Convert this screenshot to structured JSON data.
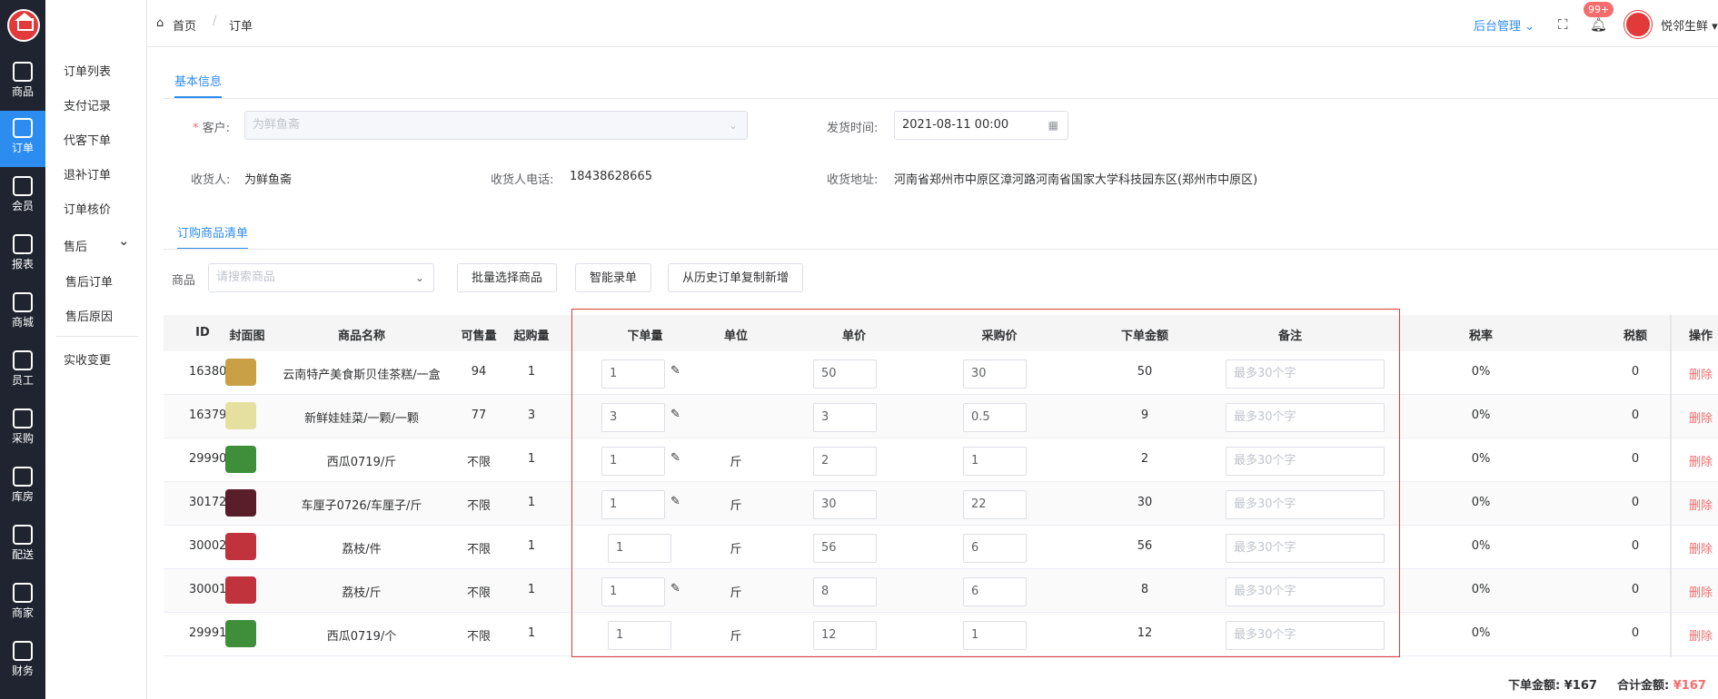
{
  "rail": [
    {
      "label": "商品",
      "icon": "bag-icon"
    },
    {
      "label": "订单",
      "icon": "order-icon"
    },
    {
      "label": "会员",
      "icon": "user-icon"
    },
    {
      "label": "报表",
      "icon": "chart-icon"
    },
    {
      "label": "商城",
      "icon": "store-icon"
    },
    {
      "label": "员工",
      "icon": "staff-icon"
    },
    {
      "label": "采购",
      "icon": "purchase-icon"
    },
    {
      "label": "库房",
      "icon": "warehouse-icon"
    },
    {
      "label": "配送",
      "icon": "truck-icon"
    },
    {
      "label": "商家",
      "icon": "shop-icon"
    },
    {
      "label": "财务",
      "icon": "yen-icon"
    }
  ],
  "subnav": [
    "订单列表",
    "支付记录",
    "代客下单",
    "退补订单",
    "订单核价",
    "售后",
    "售后订单",
    "售后原因",
    "实收变更"
  ],
  "breadcrumb": {
    "home": "首页",
    "current": "订单"
  },
  "topbar": {
    "admin": "后台管理",
    "badge": "99+",
    "user": "悦邻生鲜"
  },
  "section1": "基本信息",
  "form": {
    "customer_label": "客户:",
    "customer_value": "为鲜鱼斋",
    "ship_time_label": "发货时间:",
    "ship_time_value": "2021-08-11 00:00",
    "receiver_label": "收货人:",
    "receiver_value": "为鲜鱼斋",
    "phone_label": "收货人电话:",
    "phone_value": "18438628665",
    "address_label": "收货地址:",
    "address_value": "河南省郑州市中原区漳河路河南省国家大学科技园东区(郑州市中原区)"
  },
  "section2": "订购商品清单",
  "toolbar": {
    "product_label": "商品",
    "product_placeholder": "请搜索商品",
    "batch_btn": "批量选择商品",
    "smart_btn": "智能录单",
    "history_btn": "从历史订单复制新增"
  },
  "table": {
    "headers": [
      "ID",
      "封面图",
      "商品名称",
      "可售量",
      "起购量",
      "下单量",
      "单位",
      "单价",
      "采购价",
      "下单金额",
      "备注",
      "税率",
      "税额",
      "操作"
    ],
    "note_placeholder": "最多30个字",
    "delete_label": "删除",
    "rows": [
      {
        "id": "16380",
        "name": "云南特产美食斯贝佳茶糕/一盒",
        "stock": "94",
        "min": "1",
        "qty": "1",
        "edit": true,
        "unit": "",
        "price": "50",
        "cost": "30",
        "amount": "50",
        "tax_rate": "0%",
        "tax": "0",
        "thumb": "#c9a046"
      },
      {
        "id": "16379",
        "name": "新鲜娃娃菜/一颗/一颗",
        "stock": "77",
        "min": "3",
        "qty": "3",
        "edit": true,
        "unit": "",
        "price": "3",
        "cost": "0.5",
        "amount": "9",
        "tax_rate": "0%",
        "tax": "0",
        "thumb": "#e6e0a0"
      },
      {
        "id": "29990",
        "name": "西瓜0719/斤",
        "stock": "不限",
        "min": "1",
        "qty": "1",
        "edit": true,
        "unit": "斤",
        "price": "2",
        "cost": "1",
        "amount": "2",
        "tax_rate": "0%",
        "tax": "0",
        "thumb": "#3f8f3a"
      },
      {
        "id": "30172",
        "name": "车厘子0726/车厘子/斤",
        "stock": "不限",
        "min": "1",
        "qty": "1",
        "edit": true,
        "unit": "斤",
        "price": "30",
        "cost": "22",
        "amount": "30",
        "tax_rate": "0%",
        "tax": "0",
        "thumb": "#5a1e2a"
      },
      {
        "id": "30002",
        "name": "荔枝/件",
        "stock": "不限",
        "min": "1",
        "qty": "1",
        "edit": false,
        "unit": "斤",
        "price": "56",
        "cost": "6",
        "amount": "56",
        "tax_rate": "0%",
        "tax": "0",
        "thumb": "#c0323c"
      },
      {
        "id": "30001",
        "name": "荔枝/斤",
        "stock": "不限",
        "min": "1",
        "qty": "1",
        "edit": true,
        "unit": "斤",
        "price": "8",
        "cost": "6",
        "amount": "8",
        "tax_rate": "0%",
        "tax": "0",
        "thumb": "#c0323c"
      },
      {
        "id": "29991",
        "name": "西瓜0719/个",
        "stock": "不限",
        "min": "1",
        "qty": "1",
        "edit": false,
        "unit": "斤",
        "price": "12",
        "cost": "1",
        "amount": "12",
        "tax_rate": "0%",
        "tax": "0",
        "thumb": "#3f8f3a"
      }
    ]
  },
  "footer": {
    "order_total_label": "下单金额:",
    "order_total": "¥167",
    "sum_label": "合计金额:",
    "sum_value": "¥167"
  }
}
